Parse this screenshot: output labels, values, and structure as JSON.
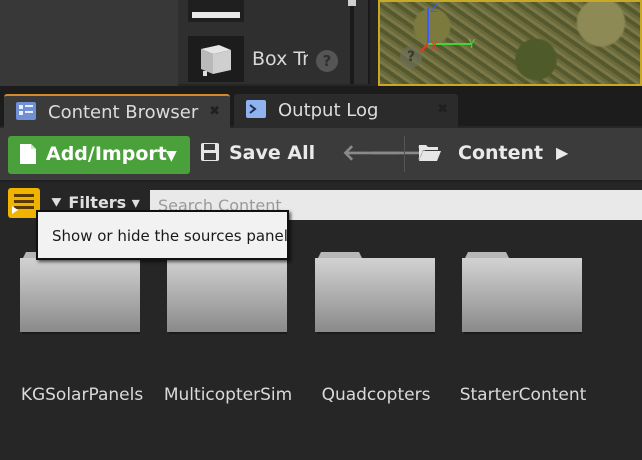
{
  "placement_panel": {
    "item_label": "Box Tr",
    "help_symbol": "?"
  },
  "viewport": {
    "axis_labels": [
      "Z",
      "Y",
      "X"
    ],
    "help_symbol": "?"
  },
  "tabs": [
    {
      "label": "Content Browser",
      "icon": "content-browser-icon",
      "active": true
    },
    {
      "label": "Output Log",
      "icon": "output-log-icon",
      "active": false
    }
  ],
  "toolbar": {
    "add_import_label": "Add/Import",
    "save_all_label": "Save All",
    "breadcrumb": "Content"
  },
  "filter": {
    "filters_label": "Filters",
    "search_placeholder": "Search Content"
  },
  "tooltip": {
    "text": "Show or hide the sources panel"
  },
  "folders": [
    {
      "name": "KGSolarPanels"
    },
    {
      "name": "MulticopterSim"
    },
    {
      "name": "Quadcopters"
    },
    {
      "name": "StarterContent"
    }
  ],
  "colors": {
    "accent_green": "#4aa03a",
    "tab_highlight": "#d18a2a",
    "sources_button": "#f0b400",
    "viewport_border": "#c9a825"
  }
}
